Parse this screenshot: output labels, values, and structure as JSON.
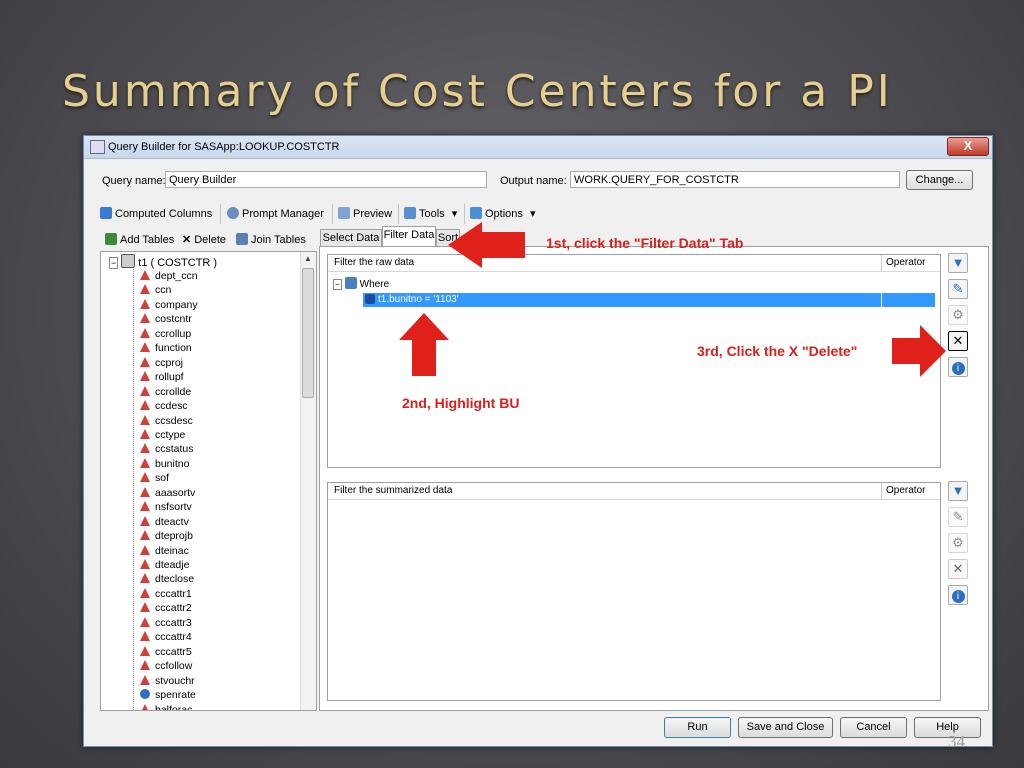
{
  "slide": {
    "title": "Summary of Cost Centers for a PI",
    "page_number": "34"
  },
  "window": {
    "title": "Query Builder for SASApp:LOOKUP.COSTCTR",
    "close_glyph": "X"
  },
  "header": {
    "query_name_label": "Query name:",
    "query_name_value": "Query Builder",
    "output_name_label": "Output name:",
    "output_name_value": "WORK.QUERY_FOR_COSTCTR",
    "change_button": "Change..."
  },
  "toolbar": {
    "computed_columns": "Computed Columns",
    "prompt_manager": "Prompt Manager",
    "preview": "Preview",
    "tools": "Tools",
    "options": "Options",
    "dropdown_glyph": "▾"
  },
  "left_toolbar": {
    "add_tables": "Add Tables",
    "delete": "Delete",
    "join_tables": "Join Tables"
  },
  "tree": {
    "root": "t1 ( COSTCTR )",
    "items": [
      "dept_ccn",
      "ccn",
      "company",
      "costcntr",
      "ccrollup",
      "function",
      "ccproj",
      "rollupf",
      "ccrollde",
      "ccdesc",
      "ccsdesc",
      "cctype",
      "ccstatus",
      "bunitno",
      "sof",
      "aaasortv",
      "nsfsortv",
      "dteactv",
      "dteprojb",
      "dteinac",
      "dteadje",
      "dteclose",
      "cccattr1",
      "cccattr2",
      "cccattr3",
      "cccattr4",
      "cccattr5",
      "ccfollow",
      "stvouchr",
      "spenrate",
      "balforac"
    ]
  },
  "tabs": {
    "select_data": "Select Data",
    "filter_data": "Filter Data",
    "sort_data": "Sort"
  },
  "raw_filter": {
    "header": "Filter the raw data",
    "operator": "Operator",
    "where": "Where",
    "condition": "t1.bunitno = '1103'"
  },
  "summarized_filter": {
    "header": "Filter the summarized data",
    "operator": "Operator"
  },
  "footer": {
    "run": "Run",
    "save_close": "Save and Close",
    "cancel": "Cancel",
    "help": "Help"
  },
  "callouts": {
    "step1": "1st, click the \"Filter Data\" Tab",
    "step2": "2nd, Highlight BU",
    "step3": "3rd, Click the X \"Delete\""
  },
  "colors": {
    "title_gold": "#e6cf8e",
    "arrow_red": "#e0201a",
    "selection_blue": "#3399ff"
  }
}
